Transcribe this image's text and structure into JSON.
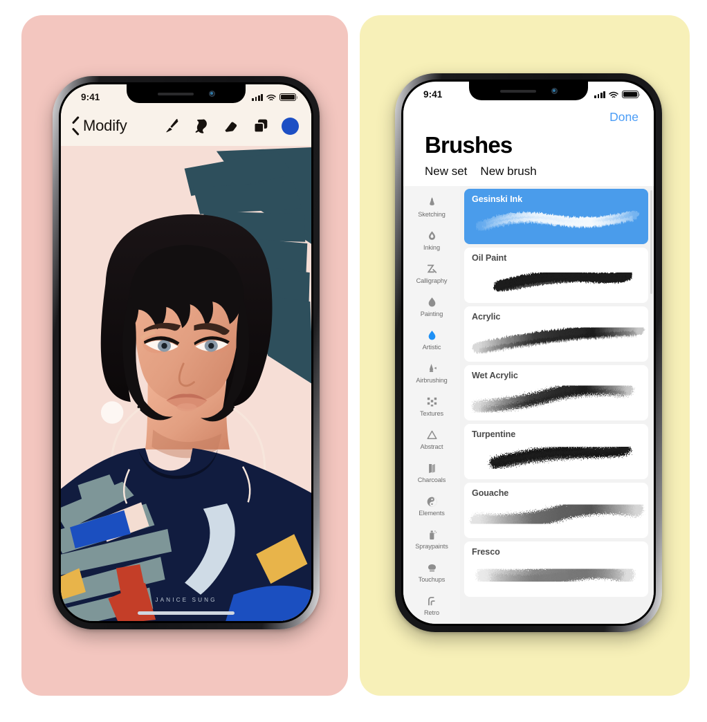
{
  "posters": {
    "left_bg": "#f3c6bf",
    "right_bg": "#f7f0b8"
  },
  "left_phone": {
    "status_bar": {
      "time": "9:41",
      "signal_icon": "cellular-bars-icon",
      "wifi_icon": "wifi-icon",
      "battery_icon": "battery-icon"
    },
    "nav": {
      "back_icon": "chevron-left-icon",
      "title": "Modify",
      "tools": [
        {
          "name": "paintbrush-icon",
          "label": "Paintbrush"
        },
        {
          "name": "smudge-icon",
          "label": "Smudge"
        },
        {
          "name": "eraser-icon",
          "label": "Eraser"
        },
        {
          "name": "layers-icon",
          "label": "Layers"
        }
      ],
      "color_swatch": "#1d4fc4"
    },
    "canvas": {
      "background": "#f6ded6",
      "artwork_signature": "JANICE SUNG",
      "palette": {
        "skin": "#e4a184",
        "hair": "#120f10",
        "teal": "#2e4f5c",
        "navy": "#111c3f",
        "sage": "#7e9698",
        "red": "#c43e28",
        "yellow": "#e8b44a",
        "blue": "#1d4fc4",
        "pale_blue": "#cfdbe6"
      }
    },
    "home_indicator": "home-indicator"
  },
  "right_phone": {
    "status_bar": {
      "time": "9:41",
      "signal_icon": "cellular-bars-icon",
      "wifi_icon": "wifi-icon",
      "battery_icon": "battery-icon"
    },
    "done_label": "Done",
    "done_color": "#4a9cf6",
    "page_title": "Brushes",
    "actions": [
      {
        "label": "New set"
      },
      {
        "label": "New brush"
      }
    ],
    "categories": [
      {
        "label": "Sketching",
        "icon": "pencil-tip-icon",
        "active": false
      },
      {
        "label": "Inking",
        "icon": "ink-drop-icon",
        "active": false
      },
      {
        "label": "Calligraphy",
        "icon": "calligraphy-icon",
        "active": false
      },
      {
        "label": "Painting",
        "icon": "paint-drop-icon",
        "active": false
      },
      {
        "label": "Artistic",
        "icon": "artistic-drop-icon",
        "active": true
      },
      {
        "label": "Airbrushing",
        "icon": "airbrush-icon",
        "active": false
      },
      {
        "label": "Textures",
        "icon": "textures-icon",
        "active": false
      },
      {
        "label": "Abstract",
        "icon": "triangle-icon",
        "active": false
      },
      {
        "label": "Charcoals",
        "icon": "charcoal-icon",
        "active": false
      },
      {
        "label": "Elements",
        "icon": "yin-yang-icon",
        "active": false
      },
      {
        "label": "Spraypaints",
        "icon": "spraycan-icon",
        "active": false
      },
      {
        "label": "Touchups",
        "icon": "touchup-icon",
        "active": false
      },
      {
        "label": "Retro",
        "icon": "retro-icon",
        "active": false
      }
    ],
    "selected_color": "#4a9ceb",
    "brushes": [
      {
        "name": "Gesinski Ink",
        "selected": true,
        "stroke": "gesinski"
      },
      {
        "name": "Oil Paint",
        "selected": false,
        "stroke": "oil"
      },
      {
        "name": "Acrylic",
        "selected": false,
        "stroke": "acrylic"
      },
      {
        "name": "Wet Acrylic",
        "selected": false,
        "stroke": "wet"
      },
      {
        "name": "Turpentine",
        "selected": false,
        "stroke": "turpentine"
      },
      {
        "name": "Gouache",
        "selected": false,
        "stroke": "gouache"
      },
      {
        "name": "Fresco",
        "selected": false,
        "stroke": "fresco"
      }
    ]
  }
}
